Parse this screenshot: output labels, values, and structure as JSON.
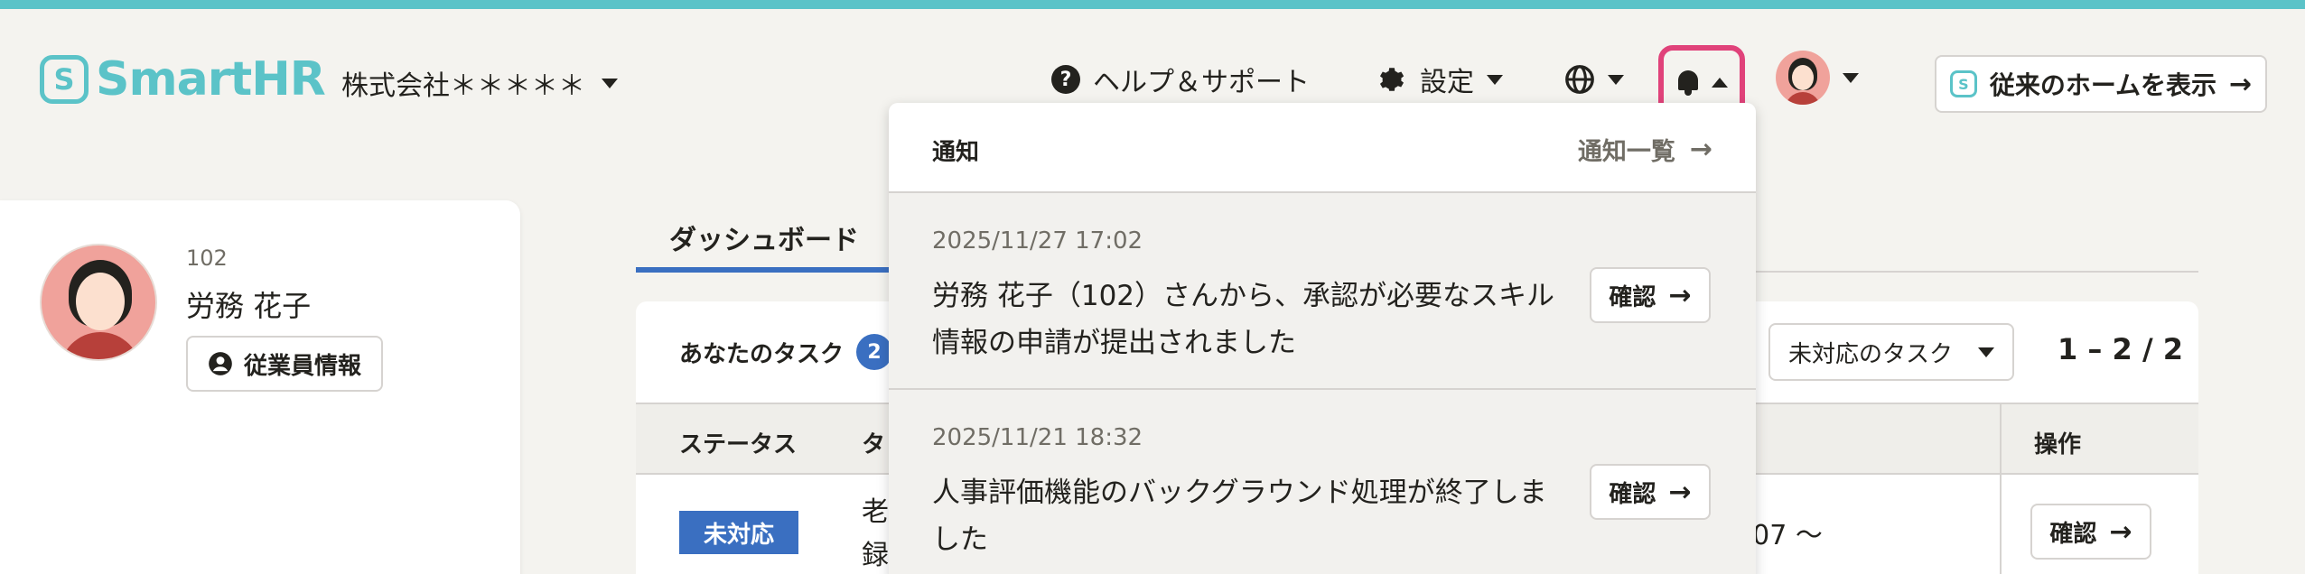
{
  "header": {
    "logo_text": "SmartHR",
    "logo_mark": "S",
    "company": "株式会社＊＊＊＊＊",
    "help": "ヘルプ＆サポート",
    "help_icon": "?",
    "settings": "設定",
    "legacy_home": "従来のホームを表示",
    "arrow": "→"
  },
  "profile": {
    "employee_no": "102",
    "name": "労務 花子",
    "employee_info_button": "従業員情報"
  },
  "tabs": {
    "dashboard": "ダッシュボード"
  },
  "tasks": {
    "title": "あなたのタスク",
    "count": "2",
    "filter_value": "未対応のタスク",
    "pager": "1 – 2 / 2",
    "columns": {
      "status": "ステータス",
      "task": "タ",
      "operation": "操作"
    },
    "rows": [
      {
        "status": "未対応",
        "text_line1": "老",
        "text_line2": "録",
        "date_fragment": "/07 〜",
        "action": "確認"
      }
    ]
  },
  "notifications": {
    "title": "通知",
    "view_all": "通知一覧",
    "items": [
      {
        "datetime": "2025/11/27 17:02",
        "message": "労務 花子（102）さんから、承認が必要なスキル情報の申請が提出されました",
        "action": "確認"
      },
      {
        "datetime": "2025/11/21 18:32",
        "message": "人事評価機能のバックグラウンド処理が終了しました",
        "action": "確認"
      }
    ]
  },
  "colors": {
    "brand": "#5bc3c8",
    "accent_blue": "#3a6fc1",
    "highlight_pink": "#e0427a"
  },
  "icons": [
    "help-icon",
    "gear-icon",
    "globe-icon",
    "bell-icon",
    "chevron-down-icon",
    "chevron-up-icon",
    "arrow-right-icon",
    "user-circle-icon"
  ]
}
